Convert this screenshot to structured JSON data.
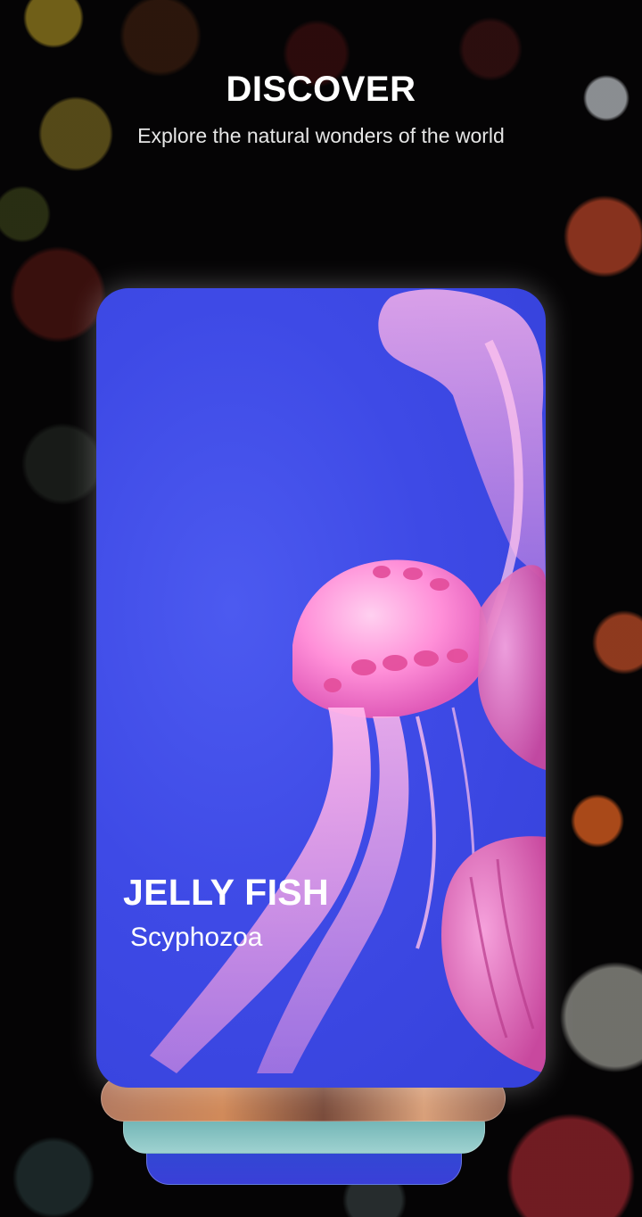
{
  "header": {
    "title": "DISCOVER",
    "subtitle": "Explore the natural wonders of the world"
  },
  "cards": [
    {
      "name": "JELLY FISH",
      "scientific_name": "Scyphozoa"
    }
  ],
  "colors": {
    "background": "#050405",
    "card_water": "#3e4ae6",
    "jellyfish": "#ff8fd8",
    "text": "#ffffff"
  }
}
